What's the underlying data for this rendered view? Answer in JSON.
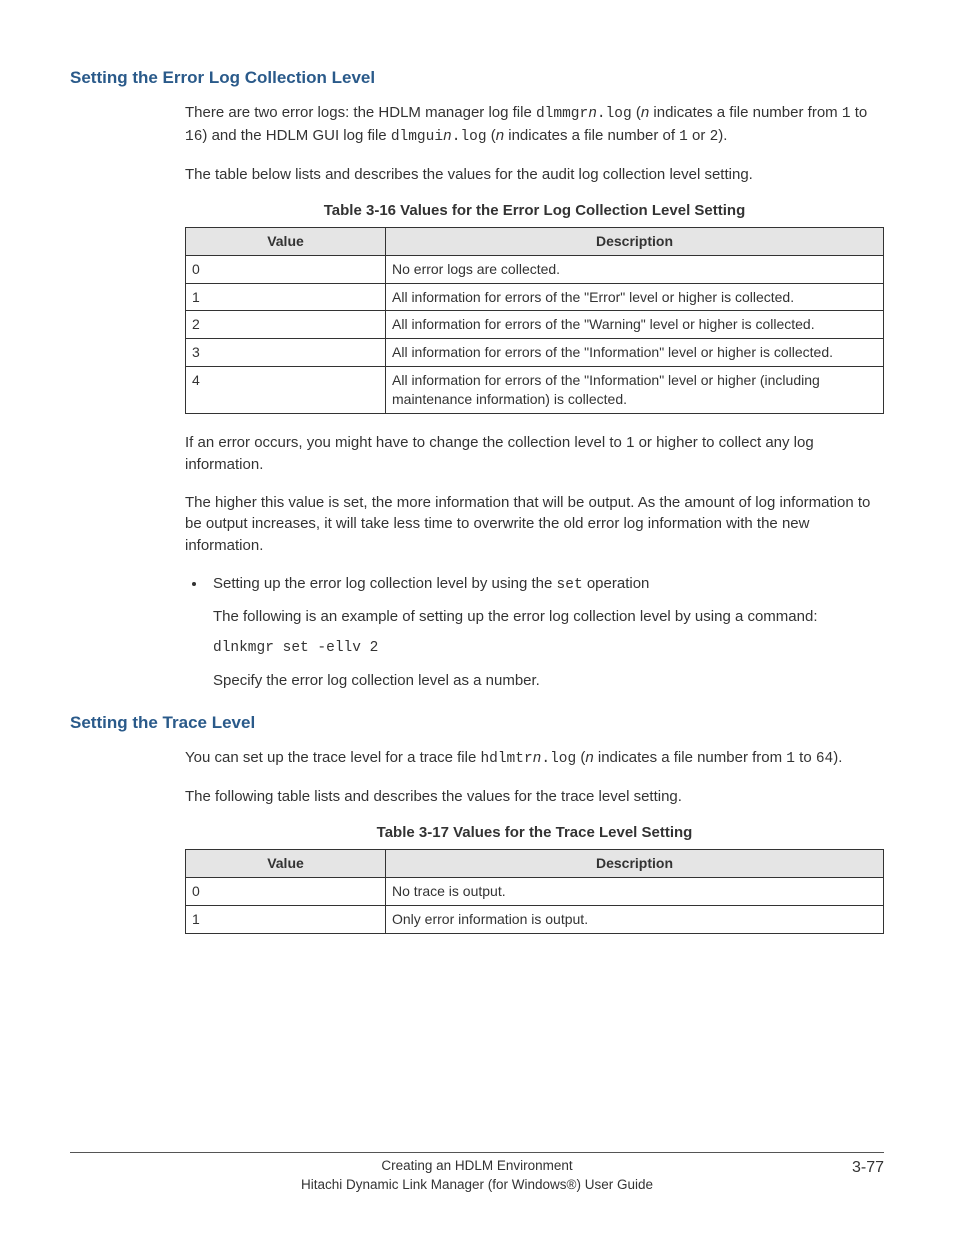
{
  "section1": {
    "heading": "Setting the Error Log Collection Level",
    "para1_a": "There are two error logs: the HDLM manager log file ",
    "para1_code1": "dlmmgr",
    "para1_ital1": "n",
    "para1_code2": ".log",
    "para1_b": " (",
    "para1_ital2": "n",
    "para1_c": " indicates a file number from ",
    "para1_code3": "1",
    "para1_d": " to ",
    "para1_code4": "16",
    "para1_e": ") and the HDLM GUI log file ",
    "para1_code5": "dlmgui",
    "para1_ital3": "n",
    "para1_code6": ".log",
    "para1_f": " (",
    "para1_ital4": "n",
    "para1_g": " indicates a file number of ",
    "para1_code7": "1",
    "para1_h": " or ",
    "para1_code8": "2",
    "para1_i": ").",
    "para2": "The table below lists and describes the values for the audit log collection level setting.",
    "table_caption": "Table 3-16 Values for the Error Log Collection Level Setting",
    "table_headers": {
      "value": "Value",
      "desc": "Description"
    },
    "table_rows": [
      {
        "value": "0",
        "desc": "No error logs are collected."
      },
      {
        "value": "1",
        "desc": "All information for errors of the \"Error\" level or higher is collected."
      },
      {
        "value": "2",
        "desc": "All information for errors of the \"Warning\" level or higher is collected."
      },
      {
        "value": "3",
        "desc": "All information for errors of the \"Information\" level or higher is collected."
      },
      {
        "value": "4",
        "desc": "All information for errors of the \"Information\" level or higher (including maintenance information) is collected."
      }
    ],
    "para3": "If an error occurs, you might have to change the collection level to 1 or higher to collect any log information.",
    "para4": "The higher this value is set, the more information that will be output. As the amount of log information to be output increases, it will take less time to overwrite the old error log information with the new information.",
    "bullet1_a": "Setting up the error log collection level by using the ",
    "bullet1_code": "set",
    "bullet1_b": " operation",
    "bullet1_sub": "The following is an example of setting up the error log collection level by using a command:",
    "code": "dlnkmgr set -ellv 2",
    "para5": "Specify the error log collection level as a number."
  },
  "section2": {
    "heading": "Setting the Trace Level",
    "para1_a": "You can set up the trace level for a trace file ",
    "para1_code1": "hdlmtr",
    "para1_ital1": "n",
    "para1_code2": ".log",
    "para1_b": " (",
    "para1_ital2": "n",
    "para1_c": " indicates a file number from ",
    "para1_code3": "1",
    "para1_d": " to ",
    "para1_code4": "64",
    "para1_e": ").",
    "para2": "The following table lists and describes the values for the trace level setting.",
    "table_caption": "Table 3-17 Values for the Trace Level Setting",
    "table_headers": {
      "value": "Value",
      "desc": "Description"
    },
    "table_rows": [
      {
        "value": "0",
        "desc": "No trace is output."
      },
      {
        "value": "1",
        "desc": "Only error information is output."
      }
    ]
  },
  "footer": {
    "line1": "Creating an HDLM Environment",
    "line2": "Hitachi Dynamic Link Manager (for Windows®) User Guide",
    "page": "3-77"
  }
}
